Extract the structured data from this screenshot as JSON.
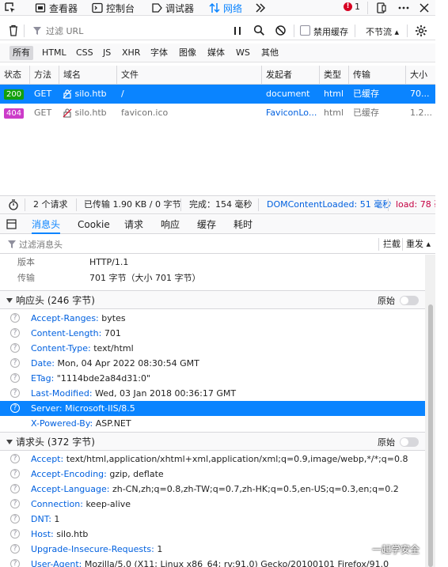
{
  "toolbar": {
    "inspector": "查看器",
    "console": "控制台",
    "debugger": "调试器",
    "network": "网络",
    "error_count": "1"
  },
  "filter": {
    "placeholder": "过滤 URL",
    "disable_cache": "禁用缓存",
    "throttle": "不节流 ▴"
  },
  "types": [
    "所有",
    "HTML",
    "CSS",
    "JS",
    "XHR",
    "字体",
    "图像",
    "媒体",
    "WS",
    "其他"
  ],
  "columns": [
    "状态",
    "方法",
    "域名",
    "文件",
    "发起者",
    "类型",
    "传输",
    "大小"
  ],
  "requests": [
    {
      "status": "200",
      "method": "GET",
      "domain": "silo.htb",
      "file": "/",
      "initiator": "document",
      "type": "html",
      "transfer": "已缓存",
      "size": "70..."
    },
    {
      "status": "404",
      "method": "GET",
      "domain": "silo.htb",
      "file": "favicon.ico",
      "initiator": "FaviconLo...",
      "type": "html",
      "transfer": "已缓存",
      "size": "1.2..."
    }
  ],
  "colors": {
    "ok": "#12a00c",
    "notfound": "#cc3bc9",
    "accent": "#0a84ff"
  },
  "summary": {
    "requests": "2 个请求",
    "transferred": "已传输 1.90 KB / 0 字节",
    "finish": "完成：154 毫秒",
    "dcl": "DOMContentLoaded: 51 毫秒",
    "load": "load: 78 毫"
  },
  "detail_tabs": [
    "消息头",
    "Cookie",
    "请求",
    "响应",
    "缓存",
    "耗时"
  ],
  "detail_filter": {
    "placeholder": "过滤消息头",
    "block": "拦截",
    "resend": "重发 ▴"
  },
  "top_info": [
    {
      "label": "版本",
      "value": "HTTP/1.1"
    },
    {
      "label": "传输",
      "value": "701 字节（大小 701 字节）"
    }
  ],
  "response_headers": {
    "title": "响应头 (246 字节)",
    "raw": "原始",
    "items": [
      {
        "name": "Accept-Ranges:",
        "value": "bytes"
      },
      {
        "name": "Content-Length:",
        "value": "701"
      },
      {
        "name": "Content-Type:",
        "value": "text/html"
      },
      {
        "name": "Date:",
        "value": "Mon, 04 Apr 2022 08:30:54 GMT"
      },
      {
        "name": "ETag:",
        "value": "\"1114bde2a84d31:0\""
      },
      {
        "name": "Last-Modified:",
        "value": "Wed, 03 Jan 2018 00:36:17 GMT"
      },
      {
        "name": "Server:",
        "value": "Microsoft-IIS/8.5"
      },
      {
        "name": "X-Powered-By:",
        "value": "ASP.NET"
      }
    ]
  },
  "request_headers": {
    "title": "请求头 (372 字节)",
    "raw": "原始",
    "items": [
      {
        "name": "Accept:",
        "value": "text/html,application/xhtml+xml,application/xml;q=0.9,image/webp,*/*;q=0.8"
      },
      {
        "name": "Accept-Encoding:",
        "value": "gzip, deflate"
      },
      {
        "name": "Accept-Language:",
        "value": "zh-CN,zh;q=0.8,zh-TW;q=0.7,zh-HK;q=0.5,en-US;q=0.3,en;q=0.2"
      },
      {
        "name": "Connection:",
        "value": "keep-alive"
      },
      {
        "name": "DNT:",
        "value": "1"
      },
      {
        "name": "Host:",
        "value": "silo.htb"
      },
      {
        "name": "Upgrade-Insecure-Requests:",
        "value": "1"
      },
      {
        "name": "User-Agent:",
        "value": "Mozilla/5.0 (X11; Linux x86_64; rv:91.0) Gecko/20100101 Firefox/91.0"
      }
    ]
  },
  "watermark": "一起学安全"
}
